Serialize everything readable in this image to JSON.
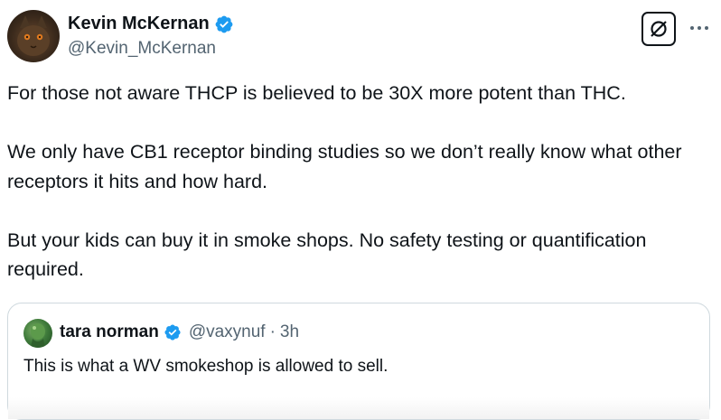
{
  "author": {
    "display_name": "Kevin McKernan",
    "handle": "@Kevin_McKernan",
    "verified": true
  },
  "tweet": {
    "paragraphs": [
      "For those not aware THCP is believed to be 30X more potent than THC.",
      "We only have CB1 receptor binding studies so we don’t really know what other receptors it hits and how hard.",
      "But your kids can buy it in smoke shops. No safety testing or quantification required."
    ]
  },
  "quoted_tweet": {
    "display_name": "tara norman",
    "verified": true,
    "handle": "@vaxynuf",
    "separator": "·",
    "time": "3h",
    "text": "This is what a WV smokeshop is allowed to sell."
  },
  "icons": {
    "grok": "grok-icon",
    "more": "more-dots-icon",
    "verified": "verified-badge-icon"
  },
  "colors": {
    "verified_blue": "#1d9bf0",
    "text_primary": "#0f1419",
    "text_secondary": "#536471",
    "border": "#cfd9de"
  }
}
